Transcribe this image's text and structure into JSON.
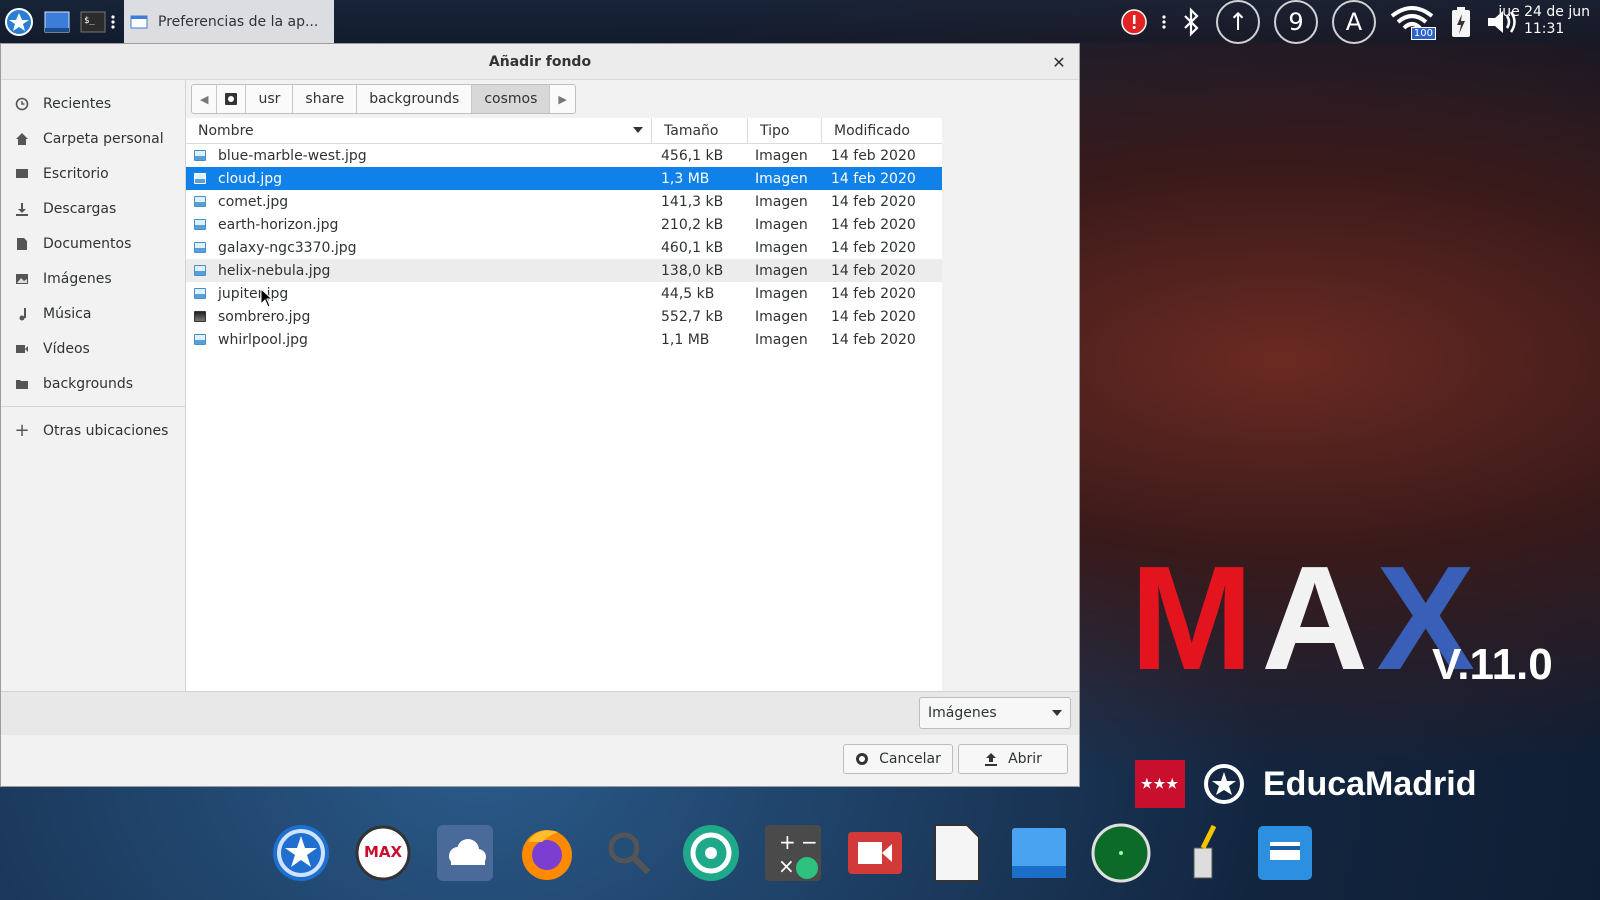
{
  "top_panel": {
    "task_title": "Preferencias de la ap...",
    "tray": {
      "battery_label": "100",
      "ring_icons": [
        "↑",
        "9",
        "A"
      ]
    },
    "clock": {
      "date": "jue 24 de jun",
      "time": "11:31"
    }
  },
  "dialog": {
    "title": "Añadir fondo",
    "sidebar": {
      "items": [
        {
          "label": "Recientes",
          "icon": "clock-icon"
        },
        {
          "label": "Carpeta personal",
          "icon": "home-icon"
        },
        {
          "label": "Escritorio",
          "icon": "desktop-icon"
        },
        {
          "label": "Descargas",
          "icon": "download-icon"
        },
        {
          "label": "Documentos",
          "icon": "document-icon"
        },
        {
          "label": "Imágenes",
          "icon": "image-icon"
        },
        {
          "label": "Música",
          "icon": "music-icon"
        },
        {
          "label": "Vídeos",
          "icon": "video-icon"
        },
        {
          "label": "backgrounds",
          "icon": "folder-icon"
        }
      ],
      "other_locations": "Otras ubicaciones"
    },
    "pathbar": {
      "crumbs": [
        "usr",
        "share",
        "backgrounds",
        "cosmos"
      ],
      "active": "cosmos"
    },
    "columns": {
      "name": "Nombre",
      "size": "Tamaño",
      "type": "Tipo",
      "modified": "Modificado"
    },
    "files": [
      {
        "name": "blue-marble-west.jpg",
        "size": "456,1 kB",
        "type": "Imagen",
        "modified": "14 feb 2020"
      },
      {
        "name": "cloud.jpg",
        "size": "1,3 MB",
        "type": "Imagen",
        "modified": "14 feb 2020"
      },
      {
        "name": "comet.jpg",
        "size": "141,3 kB",
        "type": "Imagen",
        "modified": "14 feb 2020"
      },
      {
        "name": "earth-horizon.jpg",
        "size": "210,2 kB",
        "type": "Imagen",
        "modified": "14 feb 2020"
      },
      {
        "name": "galaxy-ngc3370.jpg",
        "size": "460,1 kB",
        "type": "Imagen",
        "modified": "14 feb 2020"
      },
      {
        "name": "helix-nebula.jpg",
        "size": "138,0 kB",
        "type": "Imagen",
        "modified": "14 feb 2020"
      },
      {
        "name": "jupiter.jpg",
        "size": "44,5 kB",
        "type": "Imagen",
        "modified": "14 feb 2020"
      },
      {
        "name": "sombrero.jpg",
        "size": "552,7 kB",
        "type": "Imagen",
        "modified": "14 feb 2020"
      },
      {
        "name": "whirlpool.jpg",
        "size": "1,1 MB",
        "type": "Imagen",
        "modified": "14 feb 2020"
      }
    ],
    "selected_file": "cloud.jpg",
    "filter": "Imágenes",
    "buttons": {
      "cancel": "Cancelar",
      "open": "Abrir"
    }
  },
  "desktop": {
    "logo_letters": [
      "M",
      "A",
      "X"
    ],
    "version": "V.11.0",
    "educa_flag_stars": "★★★",
    "educa": "EducaMadrid",
    "help_glyph": "?"
  },
  "colors": {
    "selection": "#0f81e8",
    "max_red": "#e3141e",
    "max_blue": "#3a5fb8"
  }
}
